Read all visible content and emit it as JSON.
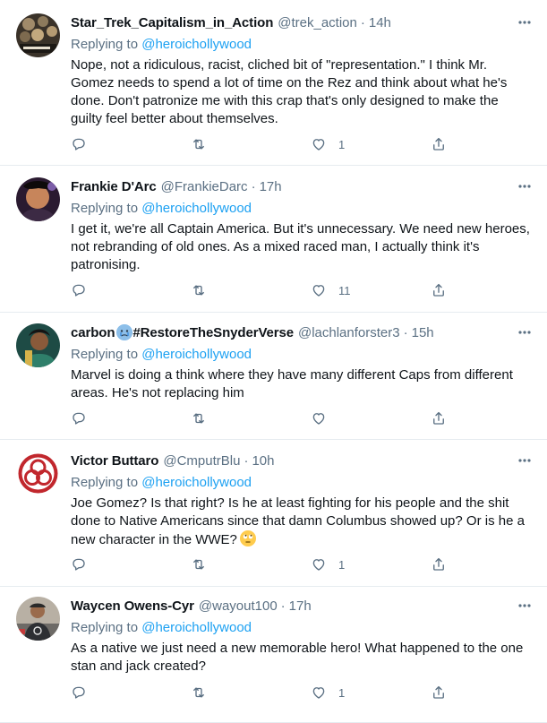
{
  "icons": {
    "more": "more-dots-icon",
    "reply": "reply-icon",
    "retweet": "retweet-icon",
    "like": "heart-icon",
    "share": "share-icon"
  },
  "colors": {
    "link": "#1da1f2",
    "secondary": "#5b7083",
    "text": "#0f1419",
    "divider": "#e6ecf0"
  },
  "replying_prefix": "Replying to",
  "tweets": [
    {
      "name": "Star_Trek_Capitalism_in_Action",
      "handle": "@trek_action",
      "dot": "·",
      "time": "14h",
      "replying_to": "@heroichollywood",
      "body": "Nope, not a ridiculous, racist, cliched bit of \"representation.\" I think Mr. Gomez needs to spend a lot of time on the Rez and think about what he's done. Don't patronize me with this crap that's only designed to make the guilty feel better about themselves.",
      "likes": "1"
    },
    {
      "name": "Frankie D'Arc",
      "handle": "@FrankieDarc",
      "dot": "·",
      "time": "17h",
      "replying_to": "@heroichollywood",
      "body": "I get it, we're all Captain America. But it's unnecessary. We need new heroes, not rebranding of old ones. As a mixed raced man, I actually think it's patronising.",
      "likes": "11"
    },
    {
      "name": "carbon",
      "name_suffix": "#RestoreTheSnyderVerse",
      "handle": "@lachlanforster3",
      "dot": "·",
      "time": "15h",
      "replying_to": "@heroichollywood",
      "body": "Marvel is doing a think where they have many different Caps from different areas. He's not replacing him",
      "likes": ""
    },
    {
      "name": "Victor Buttaro",
      "handle": "@CmputrBlu",
      "dot": "·",
      "time": "10h",
      "replying_to": "@heroichollywood",
      "body": "Joe Gomez? Is that right? Is he at least fighting for his people and the shit done to Native Americans since that damn Columbus showed up? Or is he a new character in the WWE?",
      "likes": "1"
    },
    {
      "name": "Waycen Owens-Cyr",
      "handle": "@wayout100",
      "dot": "·",
      "time": "17h",
      "replying_to": "@heroichollywood",
      "body": "As a native we just need a new memorable hero! What happened to the one stan and jack created?",
      "likes": "1"
    }
  ]
}
